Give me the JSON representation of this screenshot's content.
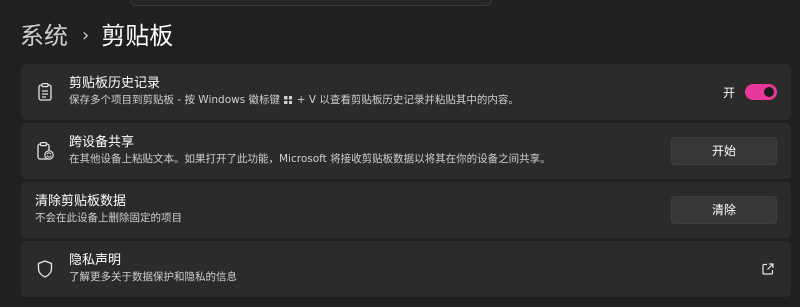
{
  "breadcrumb": {
    "parent": "系统",
    "separator": "›",
    "current": "剪贴板"
  },
  "rows": [
    {
      "title": "剪贴板历史记录",
      "desc_before": "保存多个项目到剪贴板 - 按 Windows 徽标键",
      "desc_after": "+ V 以查看剪贴板历史记录并粘贴其中的内容。",
      "icon": "clipboard-icon",
      "toggle_label": "开",
      "toggle_on": true
    },
    {
      "title": "跨设备共享",
      "desc": "在其他设备上粘贴文本。如果打开了此功能，Microsoft 将接收剪贴板数据以将其在你的设备之间共享。",
      "icon": "clipboard-sync-icon",
      "button": "开始"
    },
    {
      "title": "清除剪贴板数据",
      "desc": "不会在此设备上删除固定的项目",
      "button": "清除"
    },
    {
      "title": "隐私声明",
      "desc": "了解更多关于数据保护和隐私的信息",
      "icon": "shield-icon",
      "link_icon": "external-link-icon"
    }
  ],
  "colors": {
    "background": "#202020",
    "card": "#2b2b2b",
    "accent": "#e8389c"
  }
}
